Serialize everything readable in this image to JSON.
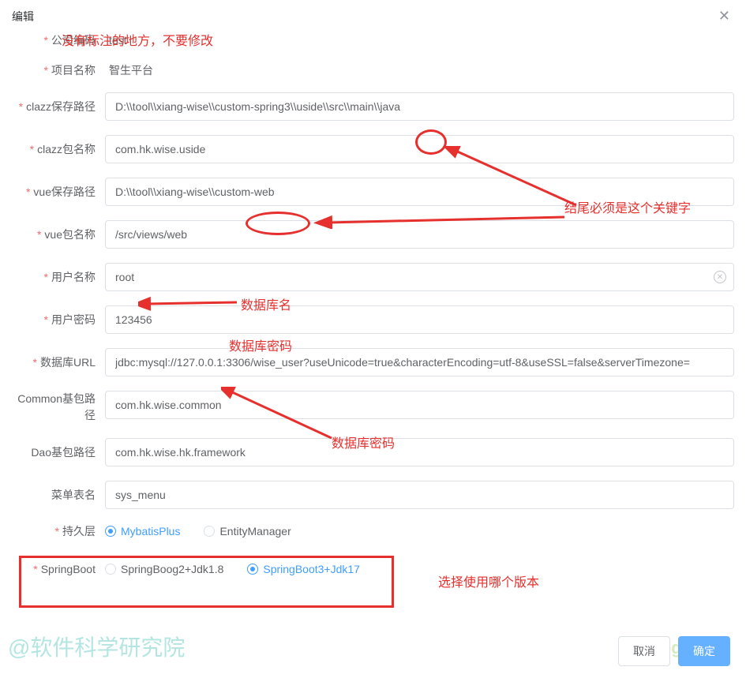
{
  "header": {
    "title": "编辑"
  },
  "annotations": {
    "top_note": "没有标注的地方，不要修改",
    "keyword_note": "结尾必须是这个关键字",
    "db_name": "数据库名",
    "db_password": "数据库密码",
    "db_password2": "数据库密码",
    "version_note": "选择使用哪个版本"
  },
  "form": {
    "company_code": {
      "label": "公司编码",
      "value": "test"
    },
    "project_name": {
      "label": "项目名称",
      "value": "智生平台"
    },
    "clazz_path": {
      "label": "clazz保存路径",
      "value": "D:\\\\tool\\\\xiang-wise\\\\custom-spring3\\\\uside\\\\src\\\\main\\\\java"
    },
    "clazz_pkg": {
      "label": "clazz包名称",
      "value": "com.hk.wise.uside"
    },
    "vue_path": {
      "label": "vue保存路径",
      "value": "D:\\\\tool\\\\xiang-wise\\\\custom-web"
    },
    "vue_pkg": {
      "label": "vue包名称",
      "value": "/src/views/web"
    },
    "username": {
      "label": "用户名称",
      "value": "root"
    },
    "password": {
      "label": "用户密码",
      "value": "123456"
    },
    "db_url": {
      "label": "数据库URL",
      "value": "jdbc:mysql://127.0.0.1:3306/wise_user?useUnicode=true&characterEncoding=utf-8&useSSL=false&serverTimezone="
    },
    "common_pkg": {
      "label": "Common基包路径",
      "value": "com.hk.wise.common"
    },
    "dao_pkg": {
      "label": "Dao基包路径",
      "value": "com.hk.wise.hk.framework"
    },
    "menu_table": {
      "label": "菜单表名",
      "value": "sys_menu"
    },
    "persistence": {
      "label": "持久层",
      "options": [
        "MybatisPlus",
        "EntityManager"
      ],
      "selected": 0
    },
    "springboot": {
      "label": "SpringBoot",
      "options": [
        "SpringBoog2+Jdk1.8",
        "SpringBoot3+Jdk17"
      ],
      "selected": 1
    }
  },
  "footer": {
    "cancel": "取消",
    "confirm": "确定"
  },
  "watermark": {
    "main": "@软件科学研究院",
    "yxt": "yxtblog.com"
  }
}
